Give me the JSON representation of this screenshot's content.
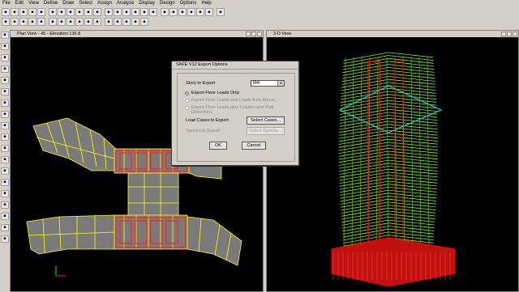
{
  "menu": [
    "File",
    "Edit",
    "View",
    "Define",
    "Draw",
    "Select",
    "Assign",
    "Analyze",
    "Display",
    "Design",
    "Options",
    "Help"
  ],
  "toolbar_row1_icons": [
    "open-icon",
    "save-icon",
    "undo-icon",
    "redo-icon",
    "lock-icon",
    "run-icon",
    "zoom-in-icon",
    "zoom-out-icon",
    "pan-icon",
    "refresh-icon",
    "3d-icon",
    "plan-icon",
    "elev-icon",
    "up-icon",
    "down-icon",
    "select-icon",
    "view-options-icon",
    "table-icon",
    "grid-icon",
    "frame-icon",
    "shell-icon",
    "link-icon",
    "show-icon",
    "model-icon"
  ],
  "toolbar_row2_icons": [
    "shape-icon",
    "filter-icon",
    "story-icon",
    "move-icon",
    "copy-icon",
    "load-icon",
    "display-icon",
    "draw-icon",
    "chart-icon",
    "mass-icon",
    "deform-icon",
    "mode-icon",
    "force-icon",
    "stress-icon",
    "design-icon",
    "check-icon"
  ],
  "left_toolbar_icons": [
    "pointer-icon",
    "reshape-icon",
    "line-icon",
    "brace-icon",
    "column-icon",
    "beam-icon",
    "wall-icon",
    "area-icon",
    "opening-icon",
    "slab-icon",
    "ramp-icon",
    "point-icon",
    "select-all-icon",
    "clear-icon",
    "previous-icon",
    "lines-icon",
    "deselect-icon",
    "intersect-icon",
    "grid-select-icon"
  ],
  "plan_view": {
    "title": "Plan View - 45 - Elevation 136.8"
  },
  "view_3d": {
    "title": "3-D View"
  },
  "dialog": {
    "title": "SAFE V12 Export Options",
    "story_label": "Story to Export",
    "story_value": "M4I",
    "options": [
      {
        "label": "Export Floor Loads Only",
        "selected": true,
        "enabled": true
      },
      {
        "label": "Export Floor Loads and Loads from Above",
        "selected": false,
        "enabled": false
      },
      {
        "label": "Export Floor Loads plus Column and Wall Distortions",
        "selected": false,
        "enabled": false
      }
    ],
    "load_cases_label": "Load Cases to Export",
    "select_cases_btn": "Select Cases...",
    "spectra_label": "Spectra to Export",
    "select_spectra_btn": "Select Spectra...",
    "ok": "OK",
    "cancel": "Cancel"
  },
  "colors": {
    "background": "#000000",
    "slab": "#808080",
    "grid": "#ffff00",
    "wall": "#ff0000",
    "frame_3d": "#8cf000",
    "highlight": "#00d8d8"
  }
}
